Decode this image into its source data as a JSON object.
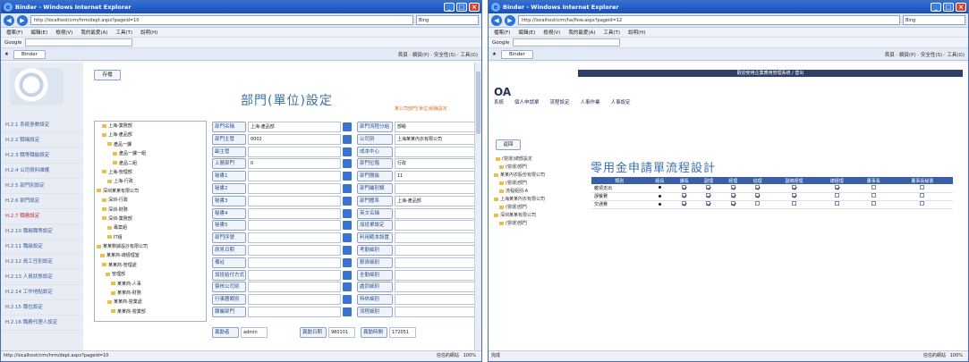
{
  "left": {
    "window_title": "Binder - Windows Internet Explorer",
    "address": "http://localhost/crm/hrm/dept.aspx?pageid=10",
    "search_placeholder": "Bing",
    "menus": [
      "檔案(F)",
      "編輯(E)",
      "檢視(V)",
      "我的最愛(A)",
      "工具(T)",
      "說明(H)"
    ],
    "google_label": "Google",
    "tab_label": "Binder",
    "tab_tools": "首頁 · 網頁(P) · 安全性(S) · 工具(O)",
    "save_button": "存檔",
    "page_title": "部門(單位)設定",
    "page_subtitle": "某公司部門(單位)組織設定",
    "side_menu": [
      "H.2.1 系統參數設定",
      "H.2.2 職稱設定",
      "H.2.3 職等職級設定",
      "H.2.4 公司資料維護",
      "H.2.5 部門別設定",
      "H.2.6 部門設定",
      "H.2.7 職務設定",
      "H.2.10 職稱職等設定",
      "H.2.11 職級設定",
      "H.2.12 員工任別設定",
      "H.2.13 人員狀態設定",
      "H.2.14 工作地點設定",
      "H.2.15 職位設定",
      "H.2.16 職務代理人設定"
    ],
    "side_selected": 6,
    "tree": [
      "上海-業務部",
      "上海-產品部",
      "產品一課",
      "產品一課一組",
      "產品二組",
      "上海-管理部",
      "上海-行政",
      "深圳某某有限公司",
      "深圳-行政",
      "深圳-財務",
      "深圳-業務部",
      "專案組",
      "IT組",
      "某某數據設計有限公司",
      "某某商-總經理室",
      "某某商-管理處",
      "管理部",
      "某某商-人事",
      "某某商-財務",
      "某某商-營業處",
      "某某商-營業部"
    ],
    "form_left": [
      {
        "label": "部門名稱",
        "value": "上海-產品部"
      },
      {
        "label": "部門主管",
        "value": "0002"
      },
      {
        "label": "副主管",
        "value": ""
      },
      {
        "label": "上層部門",
        "value": "0"
      },
      {
        "label": "秘書1",
        "value": ""
      },
      {
        "label": "秘書2",
        "value": ""
      },
      {
        "label": "秘書3",
        "value": ""
      },
      {
        "label": "秘書4",
        "value": ""
      },
      {
        "label": "秘書5",
        "value": ""
      },
      {
        "label": "部門序號",
        "value": ""
      },
      {
        "label": "原見日期",
        "value": ""
      },
      {
        "label": "備註",
        "value": ""
      },
      {
        "label": "加班給付方式",
        "value": ""
      },
      {
        "label": "簽核公司別",
        "value": ""
      },
      {
        "label": "行事曆類別",
        "value": ""
      },
      {
        "label": "隸屬部門",
        "value": ""
      }
    ],
    "form_right": [
      {
        "label": "部門流程分組",
        "value": "部級"
      },
      {
        "label": "公司別",
        "value": "上海某某內衣有限公司"
      },
      {
        "label": "成本中心",
        "value": ""
      },
      {
        "label": "部門位階",
        "value": "行政"
      },
      {
        "label": "部門層級",
        "value": "11"
      },
      {
        "label": "部門屬別類",
        "value": ""
      },
      {
        "label": "部門體系",
        "value": "上海-產品部"
      },
      {
        "label": "英文名稱",
        "value": ""
      },
      {
        "label": "加班單設定",
        "value": ""
      },
      {
        "label": "利用範本設置",
        "value": ""
      },
      {
        "label": "考勤細別",
        "value": ""
      },
      {
        "label": "薪資細別",
        "value": ""
      },
      {
        "label": "全勤細別",
        "value": ""
      },
      {
        "label": "處罰細別",
        "value": ""
      },
      {
        "label": "特休細別",
        "value": ""
      },
      {
        "label": "流程細別",
        "value": ""
      }
    ],
    "bottom": [
      {
        "label": "異動者",
        "value": "admin"
      },
      {
        "label": "異動日期",
        "value": "980101"
      },
      {
        "label": "異動時間",
        "value": "172051"
      }
    ],
    "status_url": "http://localhost/crm/hrm/dept.aspx?pageid=10",
    "status_zone": "信任的網站",
    "zoom": "100%"
  },
  "right": {
    "window_title": "Binder - Windows Internet Explorer",
    "address": "http://localhost/crm/ha/flow.aspx?pageid=12",
    "search_placeholder": "Bing",
    "menus": [
      "檔案(F)",
      "編輯(E)",
      "檢視(V)",
      "我的最愛(A)",
      "工具(T)",
      "說明(H)"
    ],
    "google_label": "Google",
    "tab_label": "Binder",
    "tab_tools": "首頁 · 網頁(P) · 安全性(S) · 工具(O)",
    "brand": "OA",
    "banner": "歡迎使用企業應用管理系統 / 登出",
    "top_menu": [
      "系統",
      "個人申請單",
      "流程設定",
      "人事作業",
      "人事設定"
    ],
    "back_button": "返回",
    "tree": [
      "(營運)總部設定",
      "(營運)部門",
      "某某內衣股份有限公司",
      "(營運)部門",
      "流程組別-A",
      "上海某某內衣有限公司",
      "(營運)部門",
      "深圳某某有限公司",
      "(營運)部門"
    ],
    "page_title": "零用金申請單流程設計",
    "columns": [
      "類別",
      "組長",
      "課長",
      "副理",
      "經理",
      "協理",
      "副總經理",
      "總經理",
      "董事長",
      "董事長秘書"
    ],
    "rows": [
      {
        "name": "雜項支出",
        "marks": [
          true,
          true,
          true,
          true,
          true,
          true,
          true,
          false,
          false
        ]
      },
      {
        "name": "誤餐費",
        "marks": [
          true,
          true,
          true,
          true,
          true,
          true,
          false,
          false,
          false
        ]
      },
      {
        "name": "交通費",
        "marks": [
          true,
          true,
          true,
          true,
          false,
          false,
          false,
          false,
          false
        ]
      }
    ],
    "status_left": "完成",
    "status_zone": "信任的網站",
    "zoom": "100%"
  }
}
